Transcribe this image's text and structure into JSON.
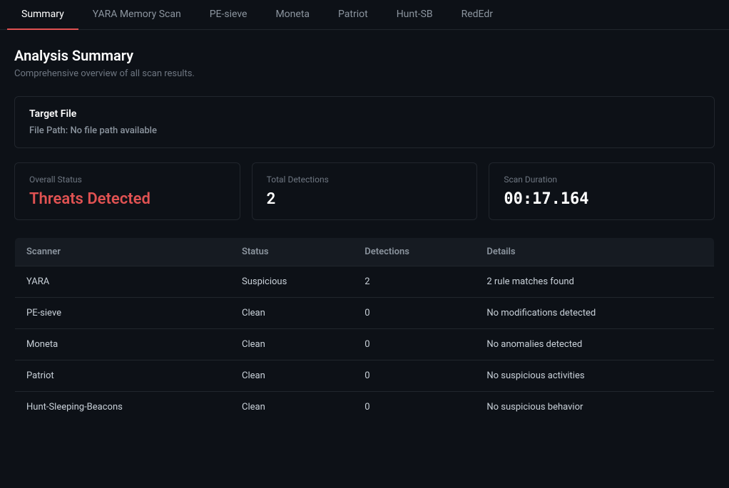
{
  "tabs": [
    {
      "label": "Summary",
      "active": true
    },
    {
      "label": "YARA Memory Scan",
      "active": false
    },
    {
      "label": "PE-sieve",
      "active": false
    },
    {
      "label": "Moneta",
      "active": false
    },
    {
      "label": "Patriot",
      "active": false
    },
    {
      "label": "Hunt-SB",
      "active": false
    },
    {
      "label": "RedEdr",
      "active": false
    }
  ],
  "header": {
    "title": "Analysis Summary",
    "subtitle": "Comprehensive overview of all scan results."
  },
  "targetFile": {
    "title": "Target File",
    "pathLabel": "File Path:",
    "pathValue": "No file path available"
  },
  "stats": {
    "overallStatus": {
      "label": "Overall Status",
      "value": "Threats Detected"
    },
    "totalDetections": {
      "label": "Total Detections",
      "value": "2"
    },
    "scanDuration": {
      "label": "Scan Duration",
      "value": "00:17.164"
    }
  },
  "table": {
    "headers": [
      "Scanner",
      "Status",
      "Detections",
      "Details"
    ],
    "rows": [
      {
        "scanner": "YARA",
        "status": "Suspicious",
        "statusClass": "suspicious",
        "detections": "2",
        "detectionsClass": "suspicious",
        "details": "2 rule matches found"
      },
      {
        "scanner": "PE-sieve",
        "status": "Clean",
        "statusClass": "clean",
        "detections": "0",
        "detectionsClass": "clean",
        "details": "No modifications detected"
      },
      {
        "scanner": "Moneta",
        "status": "Clean",
        "statusClass": "clean",
        "detections": "0",
        "detectionsClass": "clean",
        "details": "No anomalies detected"
      },
      {
        "scanner": "Patriot",
        "status": "Clean",
        "statusClass": "clean",
        "detections": "0",
        "detectionsClass": "clean",
        "details": "No suspicious activities"
      },
      {
        "scanner": "Hunt-Sleeping-Beacons",
        "status": "Clean",
        "statusClass": "clean",
        "detections": "0",
        "detectionsClass": "clean",
        "details": "No suspicious behavior"
      }
    ]
  }
}
